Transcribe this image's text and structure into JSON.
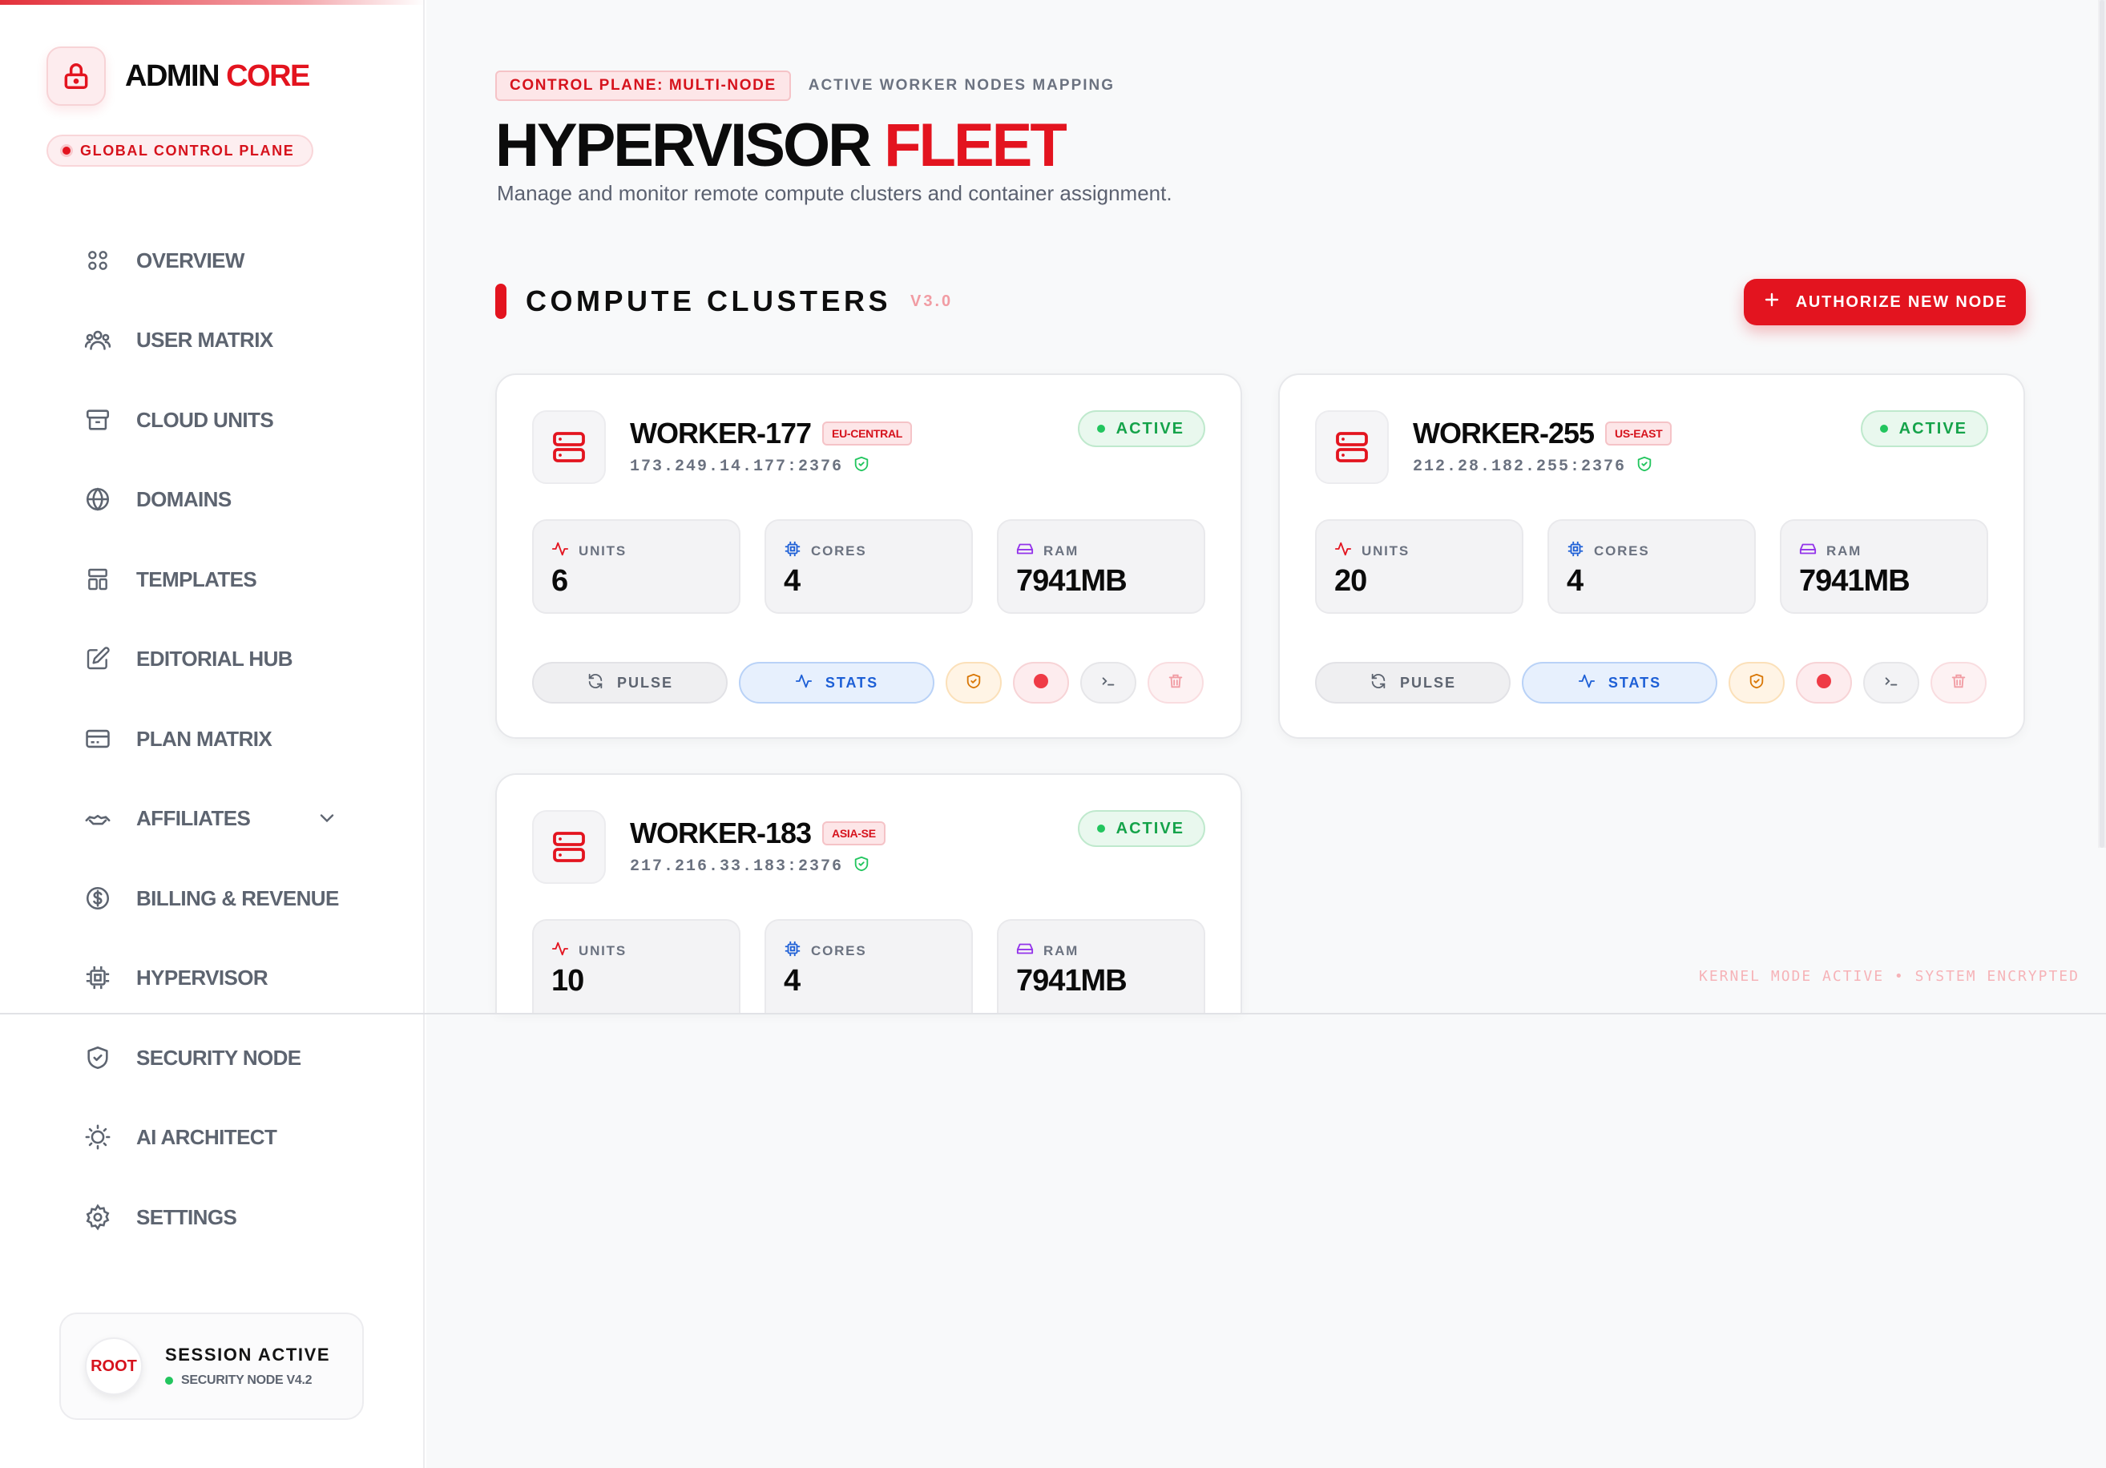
{
  "brand": {
    "name_prefix": "ADMIN",
    "name_accent": "CORE",
    "plane_badge": "GLOBAL CONTROL PLANE"
  },
  "nav": {
    "items": [
      {
        "label": "OVERVIEW",
        "icon": "grid-icon"
      },
      {
        "label": "USER MATRIX",
        "icon": "users-icon"
      },
      {
        "label": "CLOUD UNITS",
        "icon": "archive-icon"
      },
      {
        "label": "DOMAINS",
        "icon": "globe-icon"
      },
      {
        "label": "TEMPLATES",
        "icon": "layout-icon"
      },
      {
        "label": "EDITORIAL HUB",
        "icon": "edit-icon"
      },
      {
        "label": "PLAN MATRIX",
        "icon": "credit-card-icon"
      },
      {
        "label": "AFFILIATES",
        "icon": "handshake-icon"
      },
      {
        "label": "BILLING & REVENUE",
        "icon": "dollar-icon"
      },
      {
        "label": "HYPERVISOR",
        "icon": "cpu-icon"
      },
      {
        "label": "SECURITY NODE",
        "icon": "shield-icon"
      },
      {
        "label": "AI ARCHITECT",
        "icon": "bulb-icon"
      },
      {
        "label": "SETTINGS",
        "icon": "gear-icon"
      }
    ]
  },
  "session": {
    "avatar": "ROOT",
    "title": "SESSION ACTIVE",
    "subtitle": "SECURITY NODE V4.2"
  },
  "header": {
    "badge": "CONTROL PLANE: MULTI-NODE",
    "eyebrow": "ACTIVE WORKER NODES MAPPING",
    "title_main": "HYPERVISOR",
    "title_accent": "FLEET",
    "description": "Manage and monitor remote compute clusters and container assignment."
  },
  "section": {
    "title": "COMPUTE CLUSTERS",
    "version": "V3.0",
    "action_label": "AUTHORIZE NEW NODE"
  },
  "labels": {
    "units": "UNITS",
    "cores": "CORES",
    "ram": "RAM",
    "pulse": "PULSE",
    "stats": "STATS"
  },
  "nodes": [
    {
      "name": "WORKER-177",
      "region": "EU-CENTRAL",
      "address": "173.249.14.177:2376",
      "status": "ACTIVE",
      "units": "6",
      "cores": "4",
      "ram": "7941MB"
    },
    {
      "name": "WORKER-255",
      "region": "US-EAST",
      "address": "212.28.182.255:2376",
      "status": "ACTIVE",
      "units": "20",
      "cores": "4",
      "ram": "7941MB"
    },
    {
      "name": "WORKER-183",
      "region": "ASIA-SE",
      "address": "217.216.33.183:2376",
      "status": "ACTIVE",
      "units": "10",
      "cores": "4",
      "ram": "7941MB"
    }
  ],
  "footer_note": "KERNEL MODE ACTIVE • SYSTEM ENCRYPTED",
  "colors": {
    "accent": "#e3141f",
    "success": "#22c55e",
    "info": "#1d5fd6"
  }
}
